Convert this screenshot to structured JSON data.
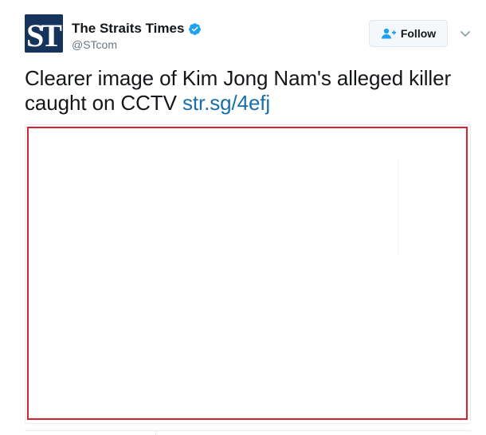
{
  "account": {
    "display_name": "The Straits Times",
    "handle": "@STcom",
    "avatar_text": "ST",
    "verified": true,
    "avatar_color": "#16335c"
  },
  "follow_button": {
    "label": "Follow",
    "icon": "add-user-icon"
  },
  "menu": {
    "icon": "chevron-down-icon"
  },
  "tweet": {
    "text": "Clearer image of Kim Jong Nam's alleged killer caught on CCTV ",
    "link_text": "str.sg/4efj",
    "link_color": "#1b6fa8"
  },
  "media": {
    "border_color": "#d6232f"
  },
  "colors": {
    "text": "#14171a",
    "muted": "#657786",
    "verified_badge": "#1da1f2"
  }
}
